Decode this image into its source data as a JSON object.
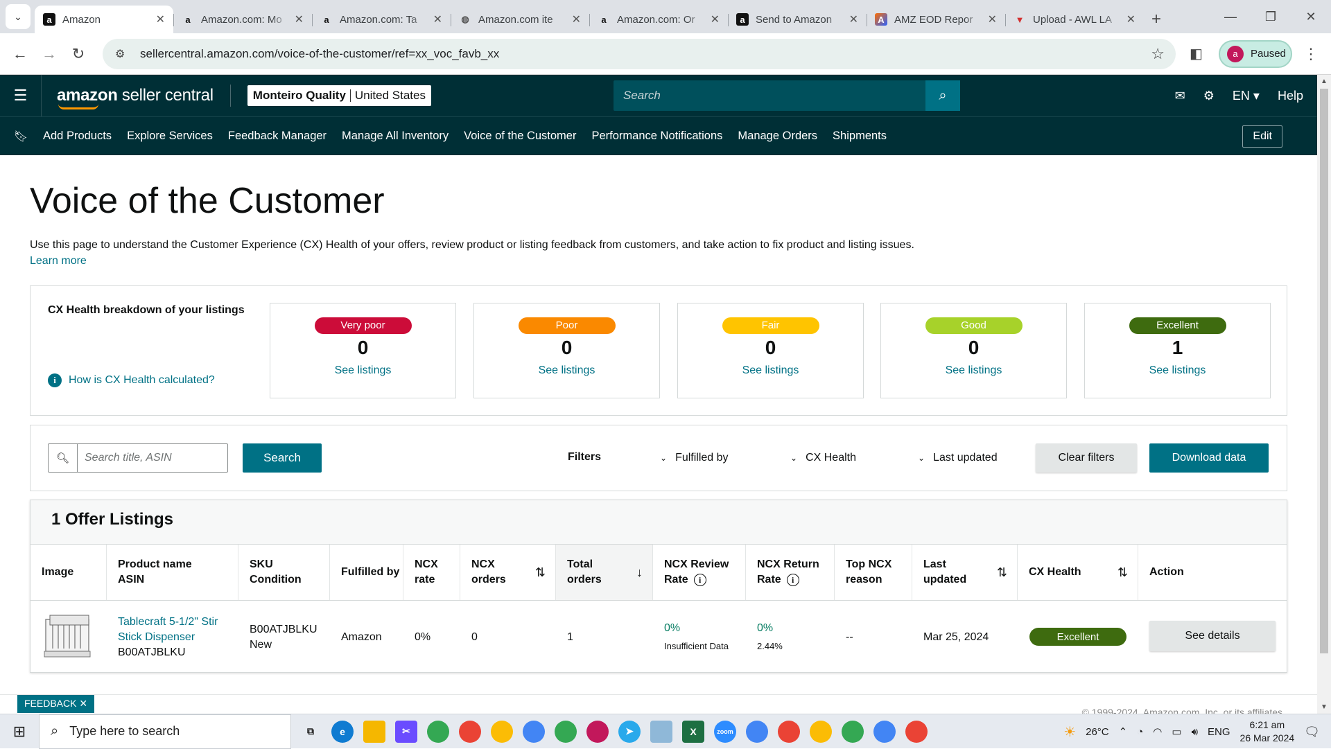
{
  "browser": {
    "tabs": [
      {
        "title": "Amazon",
        "icon": "amazon-a",
        "active": true
      },
      {
        "title": "Amazon.com: Mo",
        "icon": "amazon-a"
      },
      {
        "title": "Amazon.com: Ta",
        "icon": "amazon-a"
      },
      {
        "title": "Amazon.com ite",
        "icon": "globe"
      },
      {
        "title": "Amazon.com: Or",
        "icon": "amazon-a"
      },
      {
        "title": "Send to Amazon",
        "icon": "amazon-a-dark"
      },
      {
        "title": "AMZ EOD Repor",
        "icon": "colorful-a"
      },
      {
        "title": "Upload - AWL LA",
        "icon": "shield-red"
      }
    ],
    "url": "sellercentral.amazon.com/voice-of-the-customer/ref=xx_voc_favb_xx",
    "profile_initial": "a",
    "profile_status": "Paused"
  },
  "header": {
    "logo_text_bold": "amazon",
    "logo_text": " seller central",
    "store_name": "Monteiro Quality",
    "store_region": "United States",
    "search_placeholder": "Search",
    "lang": "EN",
    "help": "Help"
  },
  "nav": {
    "items": [
      "Add Products",
      "Explore Services",
      "Feedback Manager",
      "Manage All Inventory",
      "Voice of the Customer",
      "Performance Notifications",
      "Manage Orders",
      "Shipments"
    ],
    "edit": "Edit"
  },
  "page": {
    "title": "Voice of the Customer",
    "intro": "Use this page to understand the Customer Experience (CX) Health of your offers, review product or listing feedback from customers, and take action to fix product and listing issues.",
    "learn_more": "Learn more"
  },
  "cx_breakdown": {
    "heading": "CX Health breakdown of your listings",
    "how_link": "How is CX Health calculated?",
    "tiles": [
      {
        "label": "Very poor",
        "count": "0",
        "link": "See listings",
        "color": "#cc0c39",
        "text_color": "#ffffff"
      },
      {
        "label": "Poor",
        "count": "0",
        "link": "See listings",
        "color": "#fa8900",
        "text_color": "#ffffff"
      },
      {
        "label": "Fair",
        "count": "0",
        "link": "See listings",
        "color": "#ffc400",
        "text_color": "#ffffff"
      },
      {
        "label": "Good",
        "count": "0",
        "link": "See listings",
        "color": "#a7d22a",
        "text_color": "#ffffff"
      },
      {
        "label": "Excellent",
        "count": "1",
        "link": "See listings",
        "color": "#3e6b0f",
        "text_color": "#ffffff"
      }
    ]
  },
  "filters": {
    "search_placeholder": "Search title, ASIN",
    "search_button": "Search",
    "label": "Filters",
    "dropdowns": [
      "Fulfilled by",
      "CX Health",
      "Last updated"
    ],
    "clear": "Clear filters",
    "download": "Download data"
  },
  "listings": {
    "heading": "1 Offer Listings",
    "columns": [
      {
        "l1": "Image",
        "l2": ""
      },
      {
        "l1": "Product name",
        "l2": "ASIN"
      },
      {
        "l1": "SKU",
        "l2": "Condition"
      },
      {
        "l1": "Fulfilled by",
        "l2": ""
      },
      {
        "l1": "NCX",
        "l2": "rate"
      },
      {
        "l1": "NCX",
        "l2": "orders"
      },
      {
        "l1": "Total",
        "l2": "orders"
      },
      {
        "l1": "NCX Review",
        "l2": "Rate"
      },
      {
        "l1": "NCX Return",
        "l2": "Rate"
      },
      {
        "l1": "Top NCX",
        "l2": "reason"
      },
      {
        "l1": "Last",
        "l2": "updated"
      },
      {
        "l1": "CX Health",
        "l2": ""
      },
      {
        "l1": "Action",
        "l2": ""
      }
    ],
    "row": {
      "product_name_1": "Tablecraft 5-1/2\" Stir",
      "product_name_2": "Stick Dispenser",
      "asin": "B00ATJBLKU",
      "sku": "B00ATJBLKU",
      "condition": "New",
      "fulfilled_by": "Amazon",
      "ncx_rate": "0%",
      "ncx_orders": "0",
      "total_orders": "1",
      "review_rate": "0%",
      "review_note": "Insufficient Data",
      "return_rate": "0%",
      "return_note": "2.44%",
      "top_reason": "--",
      "last_updated": "Mar 25, 2024",
      "cx_health": "Excellent",
      "action": "See details"
    }
  },
  "footer": {
    "feedback": "FEEDBACK",
    "copyright": "© 1999-2024, Amazon.com, Inc. or its affiliates"
  },
  "taskbar": {
    "search_placeholder": "Type here to search",
    "temperature": "26°C",
    "lang": "ENG",
    "time": "6:21 am",
    "date": "26 Mar 2024"
  }
}
